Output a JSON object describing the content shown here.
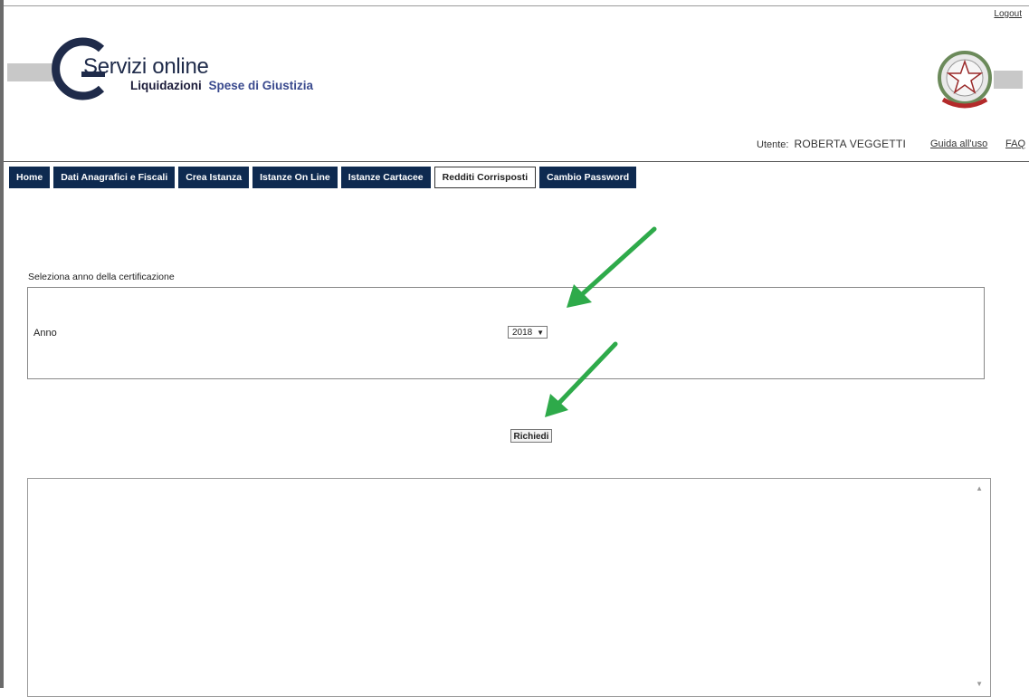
{
  "header": {
    "logout": "Logout",
    "brand_title": "Servizi online",
    "brand_sub_bold": "Liquidazioni",
    "brand_sub_colored": "Spese di Giustizia",
    "user_label": "Utente:",
    "user_name": "ROBERTA VEGGETTI",
    "guide_link": "Guida all'uso",
    "faq_link": "FAQ"
  },
  "nav": {
    "tabs": [
      {
        "label": "Home",
        "active": false
      },
      {
        "label": "Dati Anagrafici e Fiscali",
        "active": false
      },
      {
        "label": "Crea Istanza",
        "active": false
      },
      {
        "label": "Istanze On Line",
        "active": false
      },
      {
        "label": "Istanze Cartacee",
        "active": false
      },
      {
        "label": "Redditi Corrisposti",
        "active": true
      },
      {
        "label": "Cambio Password",
        "active": false
      }
    ]
  },
  "form": {
    "section_title": "Seleziona anno della certificazione",
    "year_label": "Anno",
    "year_selected": "2018",
    "submit_label": "Richiedi"
  },
  "colors": {
    "nav_bg": "#0e2a50",
    "annotation_arrow": "#2eaa4a"
  },
  "icons": {
    "logo": "servizi-online-c-logo",
    "emblem": "italian-republic-emblem",
    "dropdown": "triangle-down",
    "arrows": "green-annotation-arrow"
  }
}
